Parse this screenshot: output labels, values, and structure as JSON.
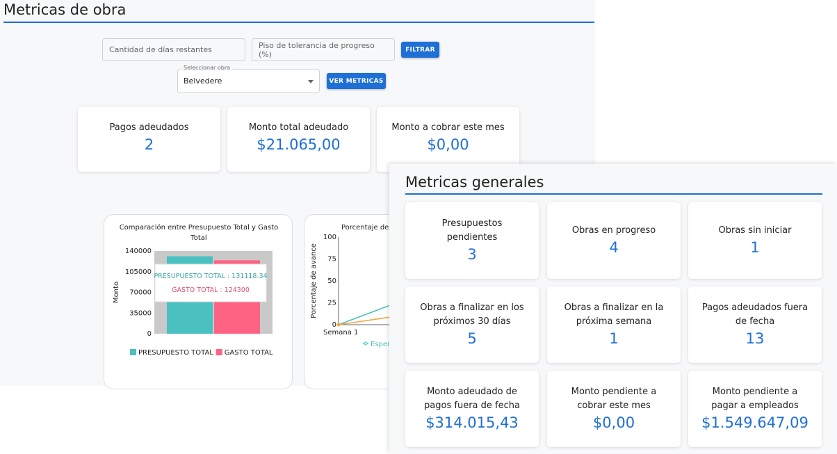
{
  "obra": {
    "title": "Metricas de obra",
    "dias_placeholder": "Cantidad de días restantes",
    "piso_placeholder": "Piso de tolerancia de progreso (%)",
    "filtrar_label": "FILTRAR",
    "select_legend": "Seleccionar obra",
    "select_value": "Belvedere",
    "ver_metricas_label": "VER METRICAS",
    "cards": [
      {
        "label": "Pagos adeudados",
        "value": "2"
      },
      {
        "label": "Monto total adeudado",
        "value": "$21.065,00"
      },
      {
        "label": "Monto a cobrar este mes",
        "value": "$0,00"
      }
    ]
  },
  "chart_data": [
    {
      "type": "bar",
      "title": "Comparación entre Presupuesto Total y Gasto Total",
      "ylabel": "Monto",
      "ylim": [
        0,
        140000
      ],
      "yticks": [
        "140000",
        "105000",
        "70000",
        "35000",
        "0"
      ],
      "series": [
        {
          "name": "PRESUPUESTO TOTAL",
          "values": [
            131118.34
          ],
          "color": "#4bc0c0"
        },
        {
          "name": "GASTO TOTAL",
          "values": [
            124300
          ],
          "color": "#ff6384"
        }
      ],
      "tooltip": [
        "PRESUPUESTO TOTAL : 131118.34",
        "GASTO TOTAL : 124300"
      ],
      "legend_position": "bottom"
    },
    {
      "type": "line",
      "title": "Porcentaje de",
      "ylabel": "Porcentaje de avance",
      "ylim": [
        0,
        100
      ],
      "yticks": [
        "100",
        "75",
        "50",
        "25",
        "0"
      ],
      "xticks": [
        "Semana 1"
      ],
      "legend_visible": "Esper",
      "series": [
        {
          "values": [
            0,
            23
          ],
          "color": "#4bc0c0"
        },
        {
          "values": [
            0,
            9
          ],
          "color": "#f5a742"
        }
      ]
    }
  ],
  "general": {
    "title": "Metricas generales",
    "cards": [
      {
        "label": "Presupuestos pendientes",
        "value": "3"
      },
      {
        "label": "Obras en progreso",
        "value": "4"
      },
      {
        "label": "Obras sin iniciar",
        "value": "1"
      },
      {
        "label": "Obras a finalizar en los próximos 30 días",
        "value": "5"
      },
      {
        "label": "Obras a finalizar en la próxima semana",
        "value": "1"
      },
      {
        "label": "Pagos adeudados fuera de fecha",
        "value": "13"
      },
      {
        "label": "Monto adeudado de pagos fuera de fecha",
        "value": "$314.015,43"
      },
      {
        "label": "Monto pendiente a cobrar este mes",
        "value": "$0,00"
      },
      {
        "label": "Monto pendiente a pagar a empleados",
        "value": "$1.549.647,09"
      }
    ]
  }
}
